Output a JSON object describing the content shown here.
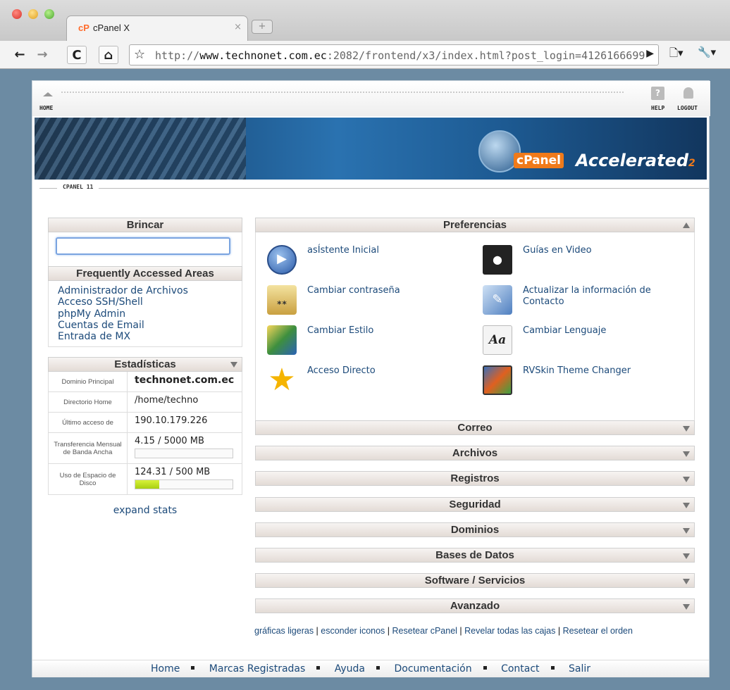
{
  "browser": {
    "tab_logo": "cP",
    "tab_title": "cPanel X",
    "tab_close": "×",
    "new_tab": "+",
    "url_prefix": "http://",
    "url_host": "www.technonet.com.ec",
    "url_rest": ":2082/frontend/x3/index.html?post_login=4126166699",
    "nav": {
      "back": "←",
      "forward": "→",
      "reload": "C",
      "home": "⌂",
      "star": "☆",
      "go": "▶",
      "page_menu": "🗋▾",
      "wrench_menu": "🔧▾"
    }
  },
  "topnav": {
    "home": "HOME",
    "help": "HELP",
    "logout": "LOGOUT"
  },
  "banner": {
    "cpanel": "cPanel",
    "accelerated": "Accelerated",
    "sub": "2"
  },
  "version": "CPANEL 11",
  "brincar": {
    "title": "Brincar",
    "value": ""
  },
  "faa": {
    "title": "Frequently Accessed Areas",
    "links": [
      "Administrador de Archivos",
      "Acceso SSH/Shell",
      "phpMy Admin",
      "Cuentas de Email",
      "Entrada de MX"
    ]
  },
  "stats": {
    "title": "Estadísticas",
    "rows": [
      {
        "label": "Dominio Principal",
        "value": "technonet.com.ec"
      },
      {
        "label": "Directorio Home",
        "value": "/home/techno"
      },
      {
        "label": "Último acceso de",
        "value": "190.10.179.226"
      },
      {
        "label": "Transferencia Mensual de Banda Ancha",
        "value": "4.15 / 5000 MB",
        "fraction": 0.0008
      },
      {
        "label": "Uso de Espacio de Disco",
        "value": "124.31 / 500 MB",
        "fraction": 0.2486
      }
    ],
    "expand": "expand stats"
  },
  "preferences": {
    "title": "Preferencias",
    "items": [
      {
        "label": "asÍstente Inicial",
        "icon": "play-icon"
      },
      {
        "label": "Guías en Video",
        "icon": "clapperboard-icon"
      },
      {
        "label": "Cambiar contraseña",
        "icon": "lock-icon"
      },
      {
        "label": "Actualizar la información de Contacto",
        "icon": "contact-card-icon"
      },
      {
        "label": "Cambiar Estilo",
        "icon": "style-icon"
      },
      {
        "label": "Cambiar Lenguaje",
        "icon": "language-icon"
      },
      {
        "label": "Acceso Directo",
        "icon": "star-icon"
      },
      {
        "label": "RVSkin Theme Changer",
        "icon": "theme-icon"
      }
    ]
  },
  "sections": [
    "Correo",
    "Archivos",
    "Registros",
    "Seguridad",
    "Dominios",
    "Bases de Datos",
    "Software / Servicios",
    "Avanzado"
  ],
  "bottom_links": [
    "gráficas ligeras",
    "esconder iconos",
    "Resetear cPanel",
    "Revelar todas las cajas",
    "Resetear el orden"
  ],
  "footer": [
    "Home",
    "Marcas Registradas",
    "Ayuda",
    "Documentación",
    "Contact",
    "Salir"
  ]
}
